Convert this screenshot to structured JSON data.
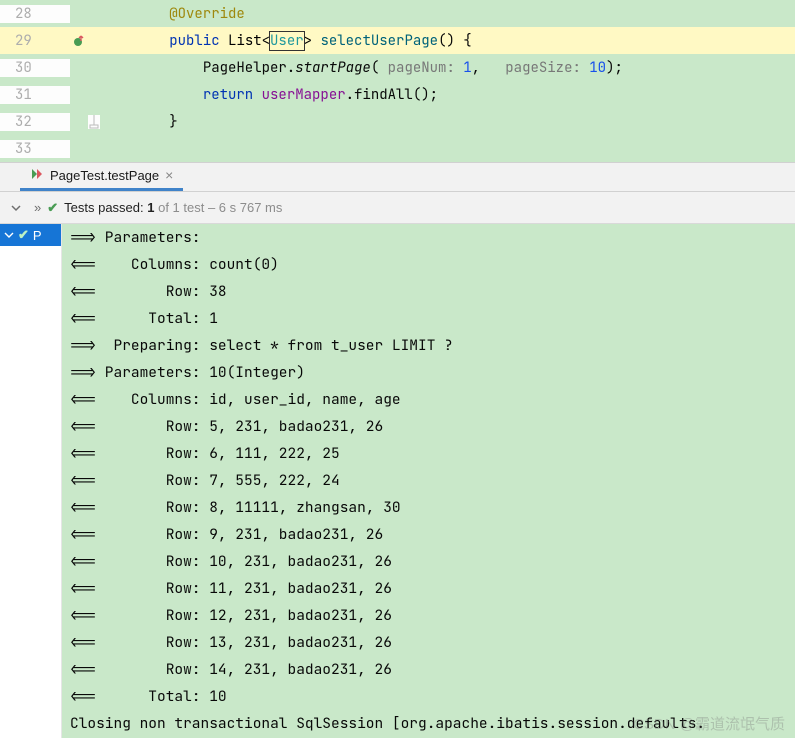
{
  "editor": {
    "lines": [
      {
        "num": "28",
        "indent": "        ",
        "tokens": [
          {
            "t": "@Override",
            "cls": "ann"
          }
        ],
        "fold": "",
        "icon": ""
      },
      {
        "num": "29",
        "indent": "        ",
        "highlight": true,
        "icon": "impl",
        "tokens": [
          {
            "t": "public ",
            "cls": "kw"
          },
          {
            "t": "List",
            "cls": "type"
          },
          {
            "t": "<",
            "cls": "type"
          },
          {
            "t": "User",
            "cls": "gen caret-box"
          },
          {
            "t": ">",
            "cls": "type"
          },
          {
            "t": " "
          },
          {
            "t": "selectUserPage",
            "cls": "meth"
          },
          {
            "t": "() {",
            "cls": ""
          }
        ]
      },
      {
        "num": "30",
        "indent": "            ",
        "tokens": [
          {
            "t": "PageHelper."
          },
          {
            "t": "startPage",
            "cls": "italic"
          },
          {
            "t": "( "
          },
          {
            "t": "pageNum: ",
            "cls": "paramhint"
          },
          {
            "t": "1",
            "cls": "num"
          },
          {
            "t": ",   "
          },
          {
            "t": "pageSize: ",
            "cls": "paramhint"
          },
          {
            "t": "10",
            "cls": "num"
          },
          {
            "t": ");"
          }
        ]
      },
      {
        "num": "31",
        "indent": "            ",
        "tokens": [
          {
            "t": "return ",
            "cls": "kw"
          },
          {
            "t": "userMapper",
            "cls": "field"
          },
          {
            "t": ".findAll();"
          }
        ]
      },
      {
        "num": "32",
        "indent": "        ",
        "fold": "end",
        "tokens": [
          {
            "t": "}"
          }
        ]
      },
      {
        "num": "33",
        "indent": "",
        "tokens": []
      }
    ]
  },
  "tab": {
    "label": "PageTest.testPage"
  },
  "status": {
    "prefix": "Tests passed: ",
    "passed": "1",
    "suffix": " of 1 test – 6 s 767 ms"
  },
  "tree": {
    "item": "P"
  },
  "console": {
    "lines": [
      "==> Parameters:",
      "<==    Columns: count(0)",
      "<==        Row: 38",
      "<==      Total: 1",
      "==>  Preparing: select * from t_user LIMIT ?",
      "==> Parameters: 10(Integer)",
      "<==    Columns: id, user_id, name, age",
      "<==        Row: 5, 231, badao231, 26",
      "<==        Row: 6, 111, 222, 25",
      "<==        Row: 7, 555, 222, 24",
      "<==        Row: 8, 11111, zhangsan, 30",
      "<==        Row: 9, 231, badao231, 26",
      "<==        Row: 10, 231, badao231, 26",
      "<==        Row: 11, 231, badao231, 26",
      "<==        Row: 12, 231, badao231, 26",
      "<==        Row: 13, 231, badao231, 26",
      "<==        Row: 14, 231, badao231, 26",
      "<==      Total: 10",
      "Closing non transactional SqlSession [org.apache.ibatis.session.defaults."
    ]
  },
  "watermark": "CSDN @霸道流氓气质"
}
